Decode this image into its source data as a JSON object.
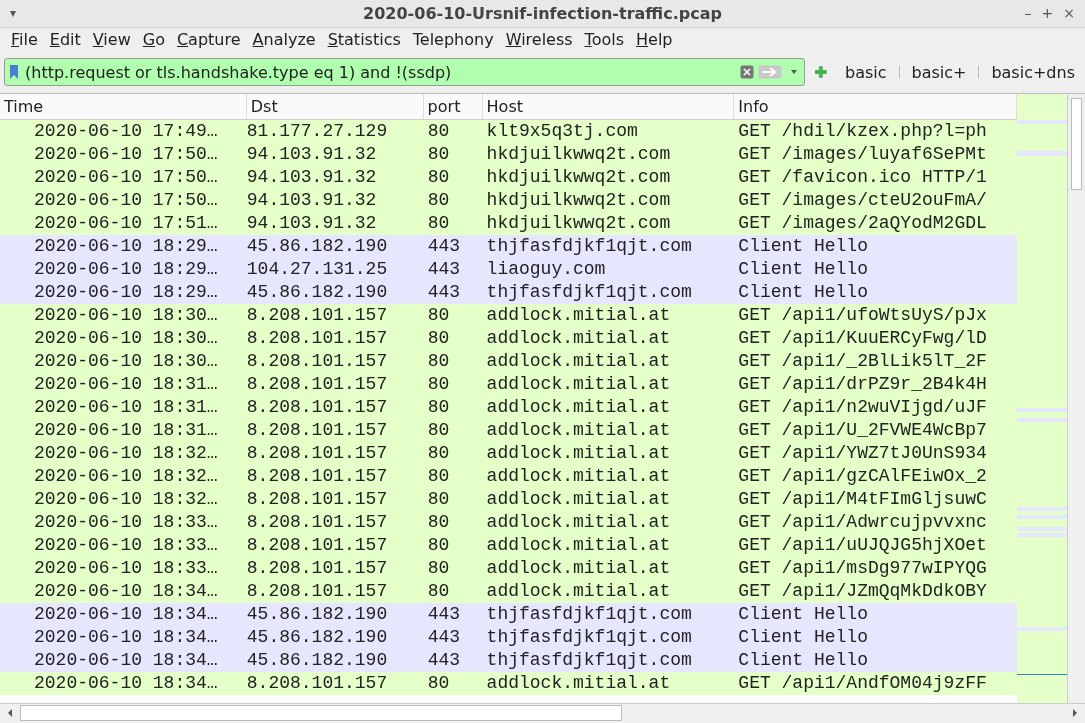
{
  "window": {
    "title": "2020-06-10-Ursnif-infection-traffic.pcap",
    "menu_glyph": "▾",
    "controls": [
      "–",
      "+",
      "×"
    ]
  },
  "menu": [
    {
      "label": "File",
      "mnemonic": true
    },
    {
      "label": "Edit",
      "mnemonic": true
    },
    {
      "label": "View",
      "mnemonic": true
    },
    {
      "label": "Go",
      "mnemonic": true
    },
    {
      "label": "Capture",
      "mnemonic": true
    },
    {
      "label": "Analyze",
      "mnemonic": true
    },
    {
      "label": "Statistics",
      "mnemonic": true
    },
    {
      "label": "Telephony",
      "mnemonic": false
    },
    {
      "label": "Wireless",
      "mnemonic": true
    },
    {
      "label": "Tools",
      "mnemonic": true
    },
    {
      "label": "Help",
      "mnemonic": true
    }
  ],
  "filter": {
    "value": "(http.request or tls.handshake.type eq 1) and !(ssdp)",
    "buttons": [
      "basic",
      "basic+",
      "basic+dns"
    ]
  },
  "table": {
    "columns": [
      "Time",
      "Dst",
      "port",
      "Host",
      "Info"
    ],
    "rows": [
      {
        "cells": [
          "2020-06-10 17:49…",
          "81.177.27.129",
          "80",
          "klt9x5q3tj.com",
          "GET /hdil/kzex.php?l=ph"
        ],
        "color": "#e4ffc7"
      },
      {
        "cells": [
          "2020-06-10 17:50…",
          "94.103.91.32",
          "80",
          "hkdjuilkwwq2t.com",
          "GET /images/luyaf6SePMt"
        ],
        "color": "#e4ffc7"
      },
      {
        "cells": [
          "2020-06-10 17:50…",
          "94.103.91.32",
          "80",
          "hkdjuilkwwq2t.com",
          "GET /favicon.ico HTTP/1"
        ],
        "color": "#e4ffc7"
      },
      {
        "cells": [
          "2020-06-10 17:50…",
          "94.103.91.32",
          "80",
          "hkdjuilkwwq2t.com",
          "GET /images/cteU2ouFmA/"
        ],
        "color": "#e4ffc7"
      },
      {
        "cells": [
          "2020-06-10 17:51…",
          "94.103.91.32",
          "80",
          "hkdjuilkwwq2t.com",
          "GET /images/2aQYodM2GDL"
        ],
        "color": "#e4ffc7"
      },
      {
        "cells": [
          "2020-06-10 18:29…",
          "45.86.182.190",
          "443",
          "thjfasfdjkf1qjt.com",
          "Client Hello"
        ],
        "color": "#e7e6ff"
      },
      {
        "cells": [
          "2020-06-10 18:29…",
          "104.27.131.25",
          "443",
          "liaoguy.com",
          "Client Hello"
        ],
        "color": "#e7e6ff"
      },
      {
        "cells": [
          "2020-06-10 18:29…",
          "45.86.182.190",
          "443",
          "thjfasfdjkf1qjt.com",
          "Client Hello"
        ],
        "color": "#e7e6ff"
      },
      {
        "cells": [
          "2020-06-10 18:30…",
          "8.208.101.157",
          "80",
          "addlock.mitial.at",
          "GET /api1/ufoWtsUyS/pJx"
        ],
        "color": "#e4ffc7"
      },
      {
        "cells": [
          "2020-06-10 18:30…",
          "8.208.101.157",
          "80",
          "addlock.mitial.at",
          "GET /api1/KuuERCyFwg/lD"
        ],
        "color": "#e4ffc7"
      },
      {
        "cells": [
          "2020-06-10 18:30…",
          "8.208.101.157",
          "80",
          "addlock.mitial.at",
          "GET /api1/_2BlLik5lT_2F"
        ],
        "color": "#e4ffc7"
      },
      {
        "cells": [
          "2020-06-10 18:31…",
          "8.208.101.157",
          "80",
          "addlock.mitial.at",
          "GET /api1/drPZ9r_2B4k4H"
        ],
        "color": "#e4ffc7"
      },
      {
        "cells": [
          "2020-06-10 18:31…",
          "8.208.101.157",
          "80",
          "addlock.mitial.at",
          "GET /api1/n2wuVIjgd/uJF"
        ],
        "color": "#e4ffc7"
      },
      {
        "cells": [
          "2020-06-10 18:31…",
          "8.208.101.157",
          "80",
          "addlock.mitial.at",
          "GET /api1/U_2FVWE4WcBp7"
        ],
        "color": "#e4ffc7"
      },
      {
        "cells": [
          "2020-06-10 18:32…",
          "8.208.101.157",
          "80",
          "addlock.mitial.at",
          "GET /api1/YWZ7tJ0UnS934"
        ],
        "color": "#e4ffc7"
      },
      {
        "cells": [
          "2020-06-10 18:32…",
          "8.208.101.157",
          "80",
          "addlock.mitial.at",
          "GET /api1/gzCAlFEiwOx_2"
        ],
        "color": "#e4ffc7"
      },
      {
        "cells": [
          "2020-06-10 18:32…",
          "8.208.101.157",
          "80",
          "addlock.mitial.at",
          "GET /api1/M4tFImGljsuwC"
        ],
        "color": "#e4ffc7"
      },
      {
        "cells": [
          "2020-06-10 18:33…",
          "8.208.101.157",
          "80",
          "addlock.mitial.at",
          "GET /api1/Adwrcujpvvxnc"
        ],
        "color": "#e4ffc7"
      },
      {
        "cells": [
          "2020-06-10 18:33…",
          "8.208.101.157",
          "80",
          "addlock.mitial.at",
          "GET /api1/uUJQJG5hjXOet"
        ],
        "color": "#e4ffc7"
      },
      {
        "cells": [
          "2020-06-10 18:33…",
          "8.208.101.157",
          "80",
          "addlock.mitial.at",
          "GET /api1/msDg977wIPYQG"
        ],
        "color": "#e4ffc7"
      },
      {
        "cells": [
          "2020-06-10 18:34…",
          "8.208.101.157",
          "80",
          "addlock.mitial.at",
          "GET /api1/JZmQqMkDdkOBY"
        ],
        "color": "#e4ffc7"
      },
      {
        "cells": [
          "2020-06-10 18:34…",
          "45.86.182.190",
          "443",
          "thjfasfdjkf1qjt.com",
          "Client Hello"
        ],
        "color": "#e7e6ff"
      },
      {
        "cells": [
          "2020-06-10 18:34…",
          "45.86.182.190",
          "443",
          "thjfasfdjkf1qjt.com",
          "Client Hello"
        ],
        "color": "#e7e6ff"
      },
      {
        "cells": [
          "2020-06-10 18:34…",
          "45.86.182.190",
          "443",
          "thjfasfdjkf1qjt.com",
          "Client Hello"
        ],
        "color": "#e7e6ff"
      },
      {
        "cells": [
          "2020-06-10 18:34…",
          "8.208.101.157",
          "80",
          "addlock.mitial.at",
          "GET /api1/AndfOM04j9zFF"
        ],
        "color": "#e4ffc7"
      }
    ]
  }
}
